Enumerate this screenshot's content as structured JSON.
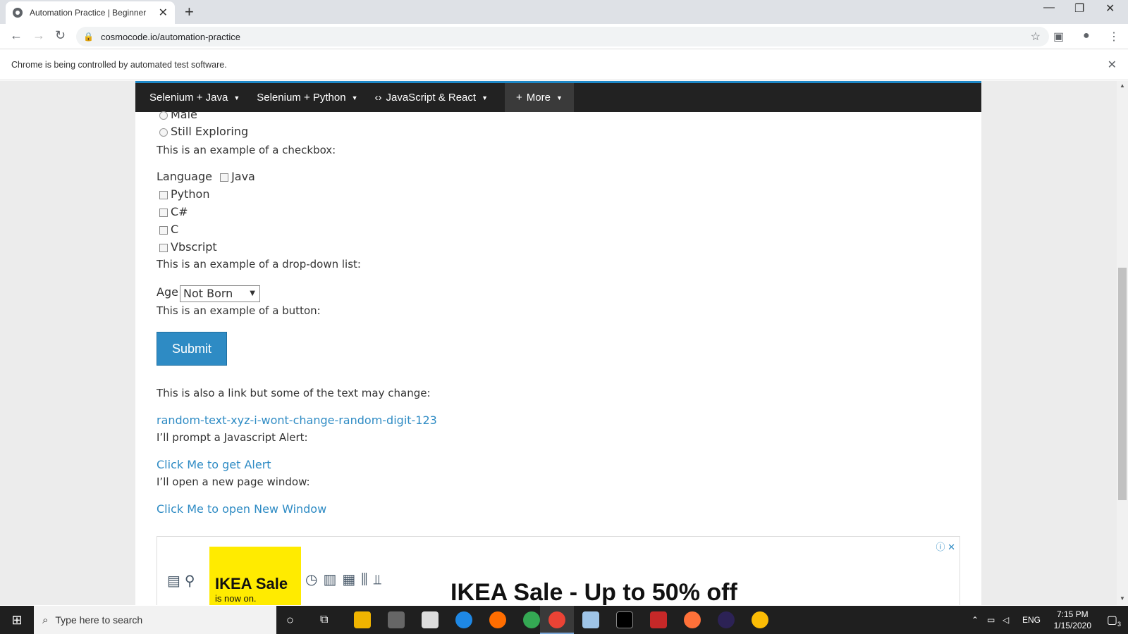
{
  "browser": {
    "tab_title": "Automation Practice | Beginner",
    "url": "cosmocode.io/automation-practice",
    "infobar_text": "Chrome is being controlled by automated test software."
  },
  "nav": {
    "items": [
      "Selenium + Java",
      "Selenium + Python",
      "JavaScript & React",
      "More"
    ]
  },
  "form": {
    "radio_options": [
      "Male",
      "Still Exploring"
    ],
    "checkbox_intro": "This is an example of a checkbox:",
    "language_label": "Language",
    "languages": [
      "Java",
      "Python",
      "C#",
      "C",
      "Vbscript"
    ],
    "dropdown_intro": "This is an example of a drop-down list:",
    "age_label": "Age",
    "age_selected": "Not Born",
    "button_intro": "This is an example of a button:",
    "submit_label": "Submit",
    "changing_link_intro": "This is also a link but some of the text may change:",
    "changing_link": "random-text-xyz-i-wont-change-random-digit-123",
    "alert_intro": "I’ll prompt a Javascript Alert:",
    "alert_link": "Click Me to get Alert",
    "window_intro": "I’ll open a new page window:",
    "window_link": "Click Me to open New Window"
  },
  "ad": {
    "brand_big": "IKEA Sale",
    "brand_small": "is now on.",
    "headline": "IKEA Sale - Up to 50% off"
  },
  "taskbar": {
    "search_placeholder": "Type here to search",
    "lang": "ENG",
    "time": "7:15 PM",
    "date": "1/15/2020",
    "notif_count": "3"
  }
}
